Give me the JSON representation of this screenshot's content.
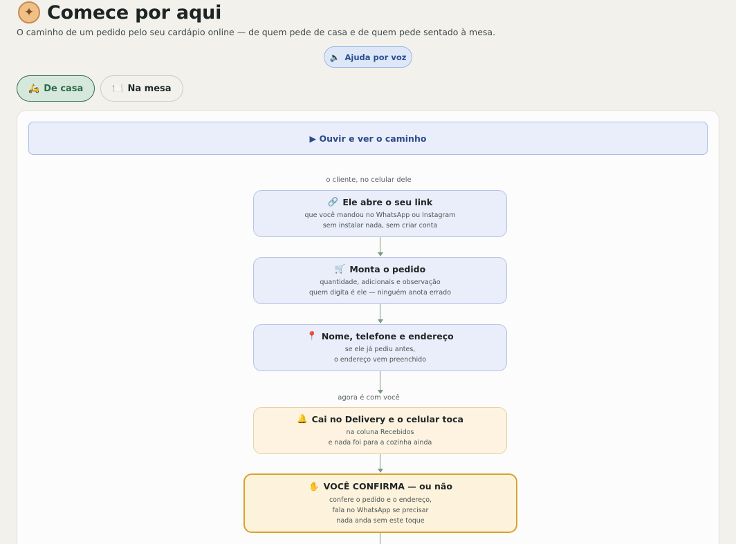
{
  "header": {
    "icon": "compass-icon",
    "title": "Comece por aqui",
    "subtitle": "O caminho de um pedido pelo seu cardápio online — de quem pede de casa e de quem pede sentado à mesa."
  },
  "voice_help": {
    "icon": "speaker-icon",
    "label": "Ajuda por voz"
  },
  "tabs": [
    {
      "icon": "scooter-icon",
      "glyph": "🛵",
      "label": "De casa",
      "active": true
    },
    {
      "icon": "plate-icon",
      "glyph": "🍽️",
      "label": "Na mesa",
      "active": false
    }
  ],
  "flow": {
    "play_label": "▶ Ouvir e ver o caminho",
    "caption_customer": "o cliente, no celular dele",
    "caption_you": "agora é com você",
    "steps": [
      {
        "icon": "link-icon",
        "glyph": "🔗",
        "title": "Ele abre o seu link",
        "line1": "que você mandou no WhatsApp ou Instagram",
        "line2": "sem instalar nada, sem criar conta"
      },
      {
        "icon": "cart-icon",
        "glyph": "🛒",
        "title": "Monta o pedido",
        "line1": "quantidade, adicionais e observação",
        "line2": "quem digita é ele — ninguém anota errado"
      },
      {
        "icon": "pin-icon",
        "glyph": "📍",
        "title": "Nome, telefone e endereço",
        "line1": "se ele já pediu antes,",
        "line2": "o endereço vem preenchido"
      },
      {
        "icon": "bell-icon",
        "glyph": "🔔",
        "title": "Cai no Delivery e o celular toca",
        "line1": "na coluna Recebidos",
        "line2": "e nada foi para a cozinha ainda"
      },
      {
        "icon": "hand-icon",
        "glyph": "✋",
        "title": "VOCÊ CONFIRMA — ou não",
        "line1": "confere o pedido e o endereço,",
        "line2": "fala no WhatsApp se precisar",
        "line3": "nada anda sem este toque"
      }
    ]
  },
  "colors": {
    "accent_green": "#2e6b4a",
    "accent_blue": "#2c4f8f",
    "gold": "#d9a22a"
  }
}
